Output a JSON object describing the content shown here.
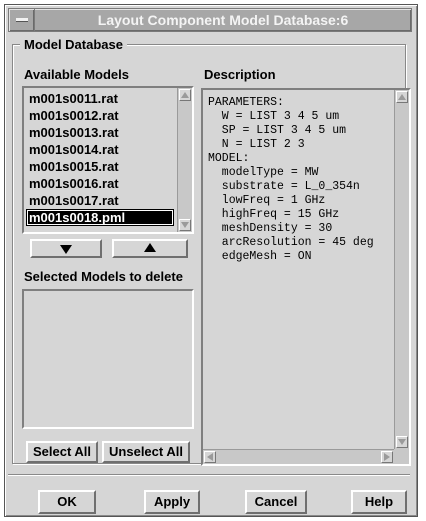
{
  "window": {
    "title": "Layout Component Model Database:6"
  },
  "group": {
    "title": "Model Database"
  },
  "available_models": {
    "label": "Available Models",
    "items": [
      {
        "label": "m001s0011.rat",
        "selected": false
      },
      {
        "label": "m001s0012.rat",
        "selected": false
      },
      {
        "label": "m001s0013.rat",
        "selected": false
      },
      {
        "label": "m001s0014.rat",
        "selected": false
      },
      {
        "label": "m001s0015.rat",
        "selected": false
      },
      {
        "label": "m001s0016.rat",
        "selected": false
      },
      {
        "label": "m001s0017.rat",
        "selected": false
      },
      {
        "label": "m001s0018.pml",
        "selected": true
      }
    ]
  },
  "move": {
    "down_icon": "triangle-down-icon",
    "up_icon": "triangle-up-icon"
  },
  "selected_models": {
    "label": "Selected Models to delete",
    "items": []
  },
  "description": {
    "label": "Description",
    "lines": [
      "PARAMETERS:",
      "  W = LIST 3 4 5 um",
      "  SP = LIST 3 4 5 um",
      "  N = LIST 2 3",
      "MODEL:",
      "  modelType = MW",
      "  substrate = L_0_354n",
      "  lowFreq = 1 GHz",
      "  highFreq = 15 GHz",
      "  meshDensity = 30",
      "  arcResolution = 45 deg",
      "  edgeMesh = ON"
    ]
  },
  "buttons": {
    "select_all": "Select All",
    "unselect_all": "Unselect All",
    "ok": "OK",
    "apply": "Apply",
    "cancel": "Cancel",
    "help": "Help"
  },
  "colors": {
    "window_bg": "#d6d6d6",
    "titlebar_bg": "#a7a7a7",
    "selection_bg": "#000000",
    "selection_fg": "#ffffff"
  }
}
